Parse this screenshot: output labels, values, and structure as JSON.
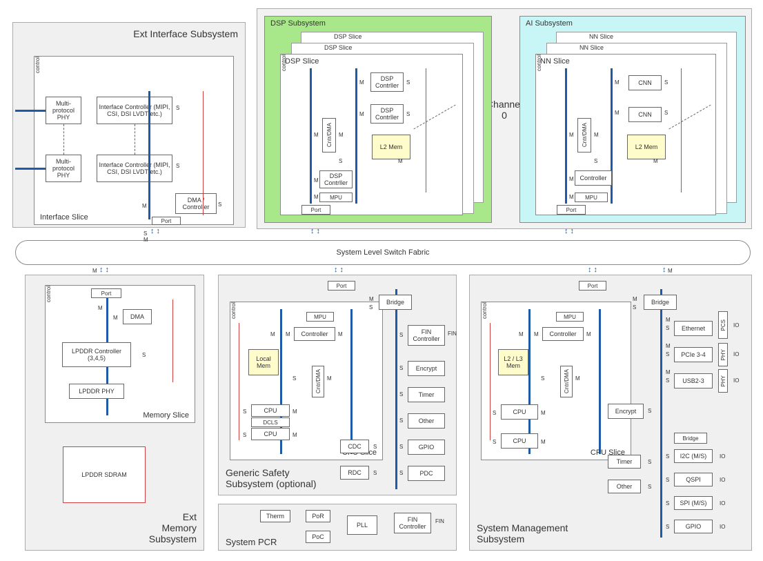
{
  "fabric": "System Level Switch Fabric",
  "channel": "Channel 0",
  "ext_if": {
    "title": "Ext Interface Subsystem",
    "phy1": "Multi-protocol PHY",
    "phy2": "Multi-protocol PHY",
    "ctrl1": "Interface Controller (MIPI, CSI, DSI LVDT etc.)",
    "ctrl2": "Interface Controller (MIPI, CSI, DSI LVDT etc.)",
    "dma": "DMA / Controller",
    "slice": "Interface Slice",
    "port": "Port",
    "control": "control"
  },
  "dsp": {
    "title": "DSP Subsystem",
    "slice": "DSP Slice",
    "cntr": "Cntr/DMA",
    "ctrl1": "DSP Contrller",
    "ctrl2": "DSP Contrller",
    "ctrl3": "DSP Contrller",
    "l2": "L2 Mem",
    "mpu": "MPU",
    "port": "Port",
    "control": "control"
  },
  "ai": {
    "title": "AI Subsystem",
    "slice": "NN Slice",
    "cntr": "Cntr/DMA",
    "cnn1": "CNN",
    "cnn2": "CNN",
    "l2": "L2 Mem",
    "ctrl": "Controller",
    "mpu": "MPU",
    "port": "Port",
    "control": "control"
  },
  "mem": {
    "title": "Ext Memory Subsystem",
    "slice": "Memory Slice",
    "port": "Port",
    "dma": "DMA",
    "ctrl": "LPDDR Controller (3,4,5)",
    "phy": "LPDDR PHY",
    "sdram": "LPDDR SDRAM",
    "control": "control"
  },
  "safety": {
    "title": "Generic Safety Subsystem (optional)",
    "slice": "CPU Slice",
    "port": "Port",
    "mpu": "MPU",
    "ctrl": "Controller",
    "bridge": "Bridge",
    "local": "Local Mem",
    "cntr": "Cntr/DMA",
    "cpu": "CPU",
    "dcls": "DCLS",
    "cdc": "CDC",
    "rdc": "RDC",
    "fin": "FIN Controller",
    "encrypt": "Encrypt",
    "timer": "Timer",
    "other": "Other",
    "gpio": "GPIO",
    "pdc": "PDC",
    "control": "control",
    "io_fin": "FIN"
  },
  "pcr": {
    "title": "System PCR",
    "therm": "Therm",
    "por": "PoR",
    "poc": "PoC",
    "pll": "PLL",
    "fin": "FIN Controller",
    "io_fin": "FIN"
  },
  "mgmt": {
    "title": "System Management Subsystem",
    "slice": "CPU Slice",
    "port": "Port",
    "mpu": "MPU",
    "ctrl": "Controller",
    "bridge": "Bridge",
    "bridge2": "Bridge",
    "l2l3": "L2 / L3 Mem",
    "cntr": "Cntr/DMA",
    "cpu": "CPU",
    "encrypt": "Encrypt",
    "timer": "Timer",
    "other": "Other",
    "eth": "Ethernet",
    "pcie": "PCIe 3-4",
    "usb": "USB2-3",
    "i2c": "I2C (M/S)",
    "qspi": "QSPI",
    "spi": "SPI (M/S)",
    "gpio": "GPIO",
    "pcs": "PCS",
    "phy": "PHY",
    "control": "control",
    "io": "IO"
  },
  "ports": {
    "m": "M",
    "s": "S"
  }
}
